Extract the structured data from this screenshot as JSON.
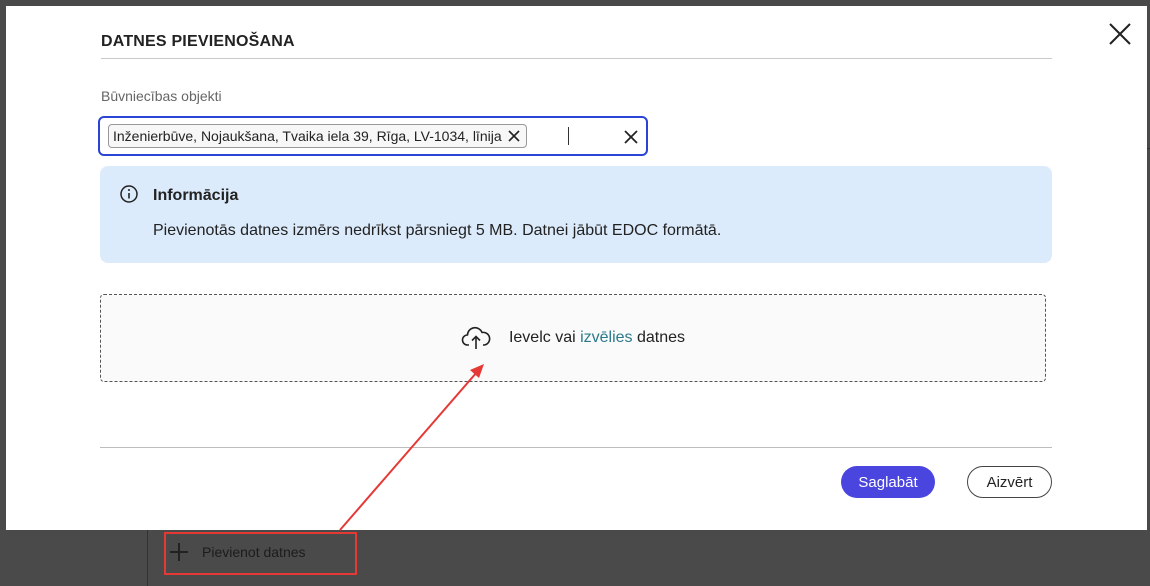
{
  "modal": {
    "title": "DATNES PIEVIENOŠANA",
    "field_label": "Būvniecības objekti",
    "selected_chip": "Inženierbūve, Nojaukšana, Tvaika iela 39, Rīga, LV-1034, līnija",
    "info": {
      "title": "Informācija",
      "text": "Pievienotās datnes izmērs nedrīkst pārsniegt 5 MB. Datnei jābūt EDOC formātā."
    },
    "dropzone": {
      "text_before": "Ievelc vai ",
      "link": "izvēlies",
      "text_after": " datnes"
    },
    "buttons": {
      "save": "Saglabāt",
      "close": "Aizvērt"
    }
  },
  "background": {
    "add_files_label": "Pievienot datnes"
  },
  "colors": {
    "primary": "#4b45e0",
    "focus_border": "#2a45d6",
    "info_bg": "#dcebfb",
    "link": "#2b7a8a",
    "annotation": "#e53935"
  }
}
